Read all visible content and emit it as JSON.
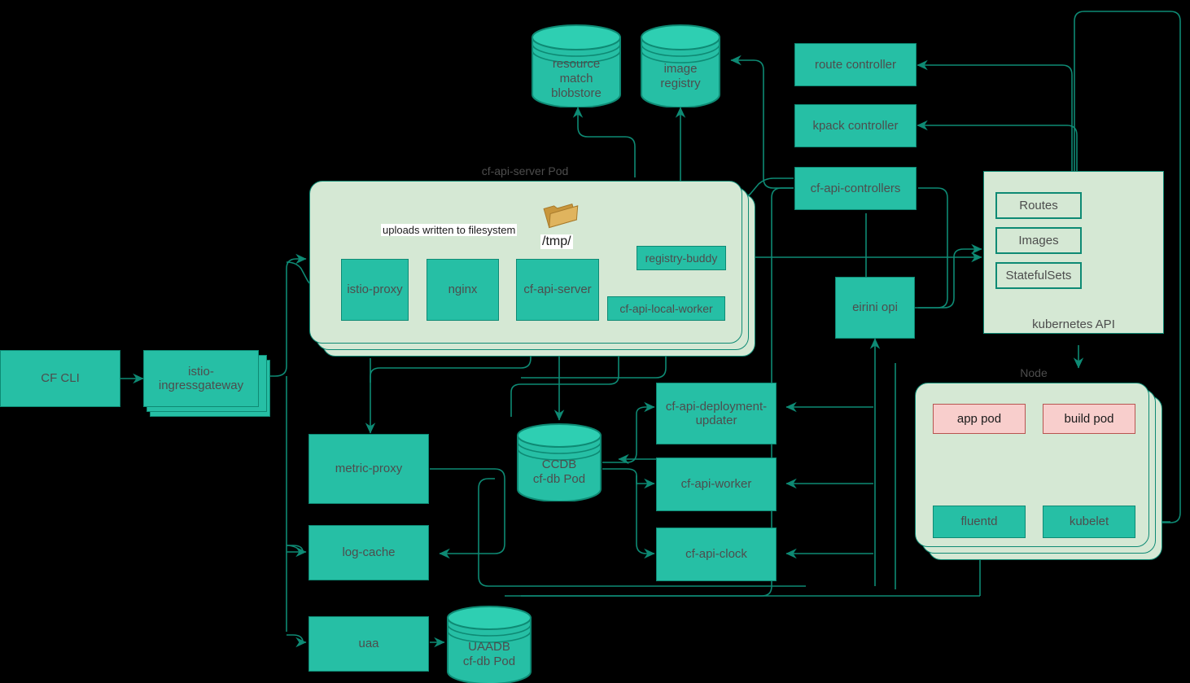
{
  "title": "Cloud Foundry on Kubernetes (cf-for-k8s) architecture diagram",
  "colors": {
    "teal": "#26bfa5",
    "teal_border": "#0e8a74",
    "group_green": "#d5e8d4",
    "pink": "#f8cecc",
    "pink_border": "#b85450",
    "text": "#4d4d4d",
    "background": "#000000",
    "folder_gold": "#d6a84f"
  },
  "captions": {
    "pod_title": "cf-api-server Pod",
    "node_title": "Node",
    "k8s_api_title": "kubernetes API"
  },
  "edge_labels": {
    "uploads": "uploads written to filesystem",
    "tmp": "/tmp/"
  },
  "nodes": {
    "cf_cli": "CF CLI",
    "istio_ingressgateway": "istio-ingressgateway",
    "istio_proxy": "istio-proxy",
    "nginx": "nginx",
    "cf_api_server": "cf-api-server",
    "cf_api_local_worker": "cf-api-local-worker",
    "registry_buddy": "registry-buddy",
    "metric_proxy": "metric-proxy",
    "log_cache": "log-cache",
    "uaa": "uaa",
    "cf_api_deployment_updater": "cf-api-deployment-updater",
    "cf_api_worker": "cf-api-worker",
    "cf_api_clock": "cf-api-clock",
    "route_controller": "route controller",
    "kpack_controller": "kpack controller",
    "cf_api_controllers": "cf-api-controllers",
    "eirini_opi": "eirini opi",
    "fluentd": "fluentd",
    "kubelet": "kubelet",
    "app_pod": "app pod",
    "build_pod": "build pod"
  },
  "datastores": {
    "resource_match_blobstore": "resource\nmatch\nblobstore",
    "resource_match_blobstore_l1": "resource",
    "resource_match_blobstore_l2": "match",
    "resource_match_blobstore_l3": "blobstore",
    "image_registry_l1": "image",
    "image_registry_l2": "registry",
    "ccdb_l1": "CCDB",
    "ccdb_l2": "cf-db Pod",
    "uaadb_l1": "UAADB",
    "uaadb_l2": "cf-db Pod"
  },
  "k8s_resources": [
    {
      "label": "Routes"
    },
    {
      "label": "Images"
    },
    {
      "label": "StatefulSets"
    }
  ],
  "icons": {
    "folder": "folder-icon",
    "database": "database-cylinder-icon"
  }
}
